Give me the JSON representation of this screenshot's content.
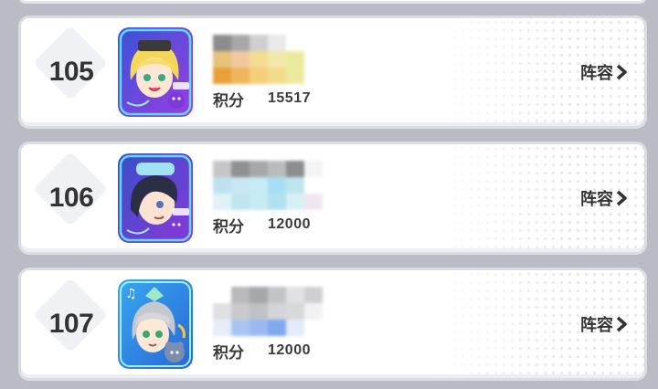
{
  "entries": [
    {
      "rank": "105",
      "score_label": "积分",
      "score": "15517",
      "lineup_label": "阵容",
      "avatar_icon": "character-portrait-blonde-icon",
      "name_colors": [
        "#8c8c8c",
        "#a7a7a7",
        "#cfcfcf",
        "#e9e9e9",
        "#ffffff",
        "#ffffff",
        "#ffffff",
        "#e7c27b",
        "#f1c8a0",
        "#f3dd92",
        "#f3e8aa",
        "#e9ea9d",
        "#ffffff",
        "#ffffff",
        "#e9a03a",
        "#f0b55c",
        "#f5ce79",
        "#f2dc8c",
        "#ecea9e",
        "#ffffff",
        "#ffffff"
      ]
    },
    {
      "rank": "106",
      "score_label": "积分",
      "score": "12000",
      "lineup_label": "阵容",
      "avatar_icon": "character-portrait-darkhair-icon",
      "name_colors": [
        "#c6c6c8",
        "#8e9094",
        "#a6a7aa",
        "#b9bbbd",
        "#8c8d90",
        "#f4f4f4",
        "#ffffff",
        "#bfe1ef",
        "#c9e7f2",
        "#c5ecf5",
        "#a8def3",
        "#bde6ef",
        "#ffffff",
        "#ffffff",
        "#dff2f7",
        "#bde6f1",
        "#c7eaf3",
        "#b2e0ef",
        "#d8f0f3",
        "#f0e6f2",
        "#ffffff"
      ]
    },
    {
      "rank": "107",
      "score_label": "积分",
      "score": "12000",
      "lineup_label": "阵容",
      "avatar_icon": "character-portrait-silverhair-icon",
      "name_colors": [
        "#ffffff",
        "#b9b9bb",
        "#a6a7aa",
        "#c3c4c7",
        "#e2e2e4",
        "#cfcfd1",
        "#ffffff",
        "#e0e0e2",
        "#c9cacd",
        "#bfc1c4",
        "#d4d5d8",
        "#d7d8da",
        "#f2f2f3",
        "#ffffff",
        "#e7edf8",
        "#a9c4f3",
        "#9ab9f0",
        "#7fa9ee",
        "#e3ebf8",
        "#ffffff",
        "#ffffff"
      ]
    }
  ]
}
